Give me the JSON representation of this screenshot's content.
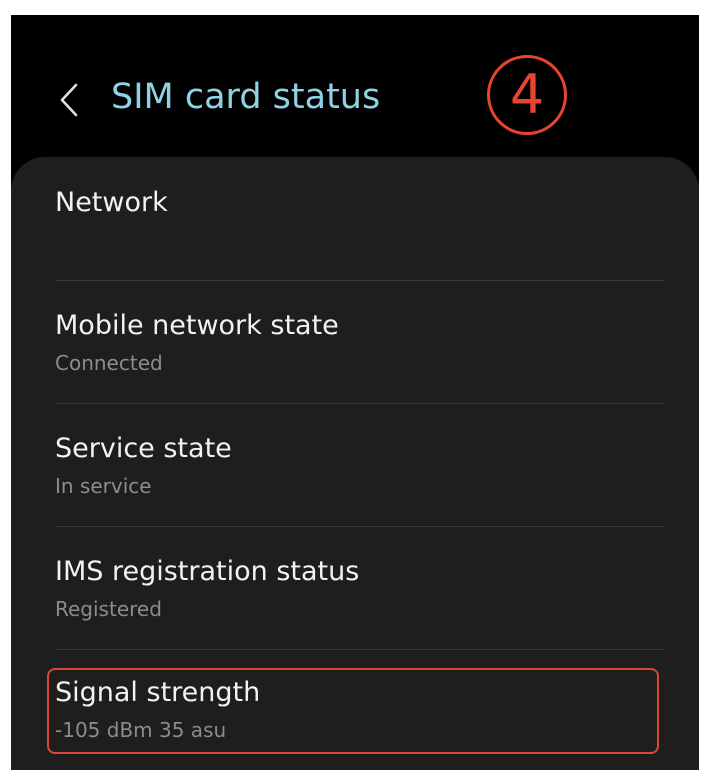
{
  "header": {
    "title": "SIM card status",
    "step_number": "4"
  },
  "rows": [
    {
      "title": "Network",
      "subtitle": ""
    },
    {
      "title": "Mobile network state",
      "subtitle": "Connected"
    },
    {
      "title": "Service state",
      "subtitle": "In service"
    },
    {
      "title": "IMS registration status",
      "subtitle": "Registered"
    },
    {
      "title": "Signal strength",
      "subtitle": "-105 dBm 35 asu"
    }
  ],
  "colors": {
    "title_accent": "#8fd2e6",
    "annotation": "#e8452f",
    "card_background": "#1e1e1e"
  },
  "icons": {
    "back": "chevron-left-icon"
  }
}
